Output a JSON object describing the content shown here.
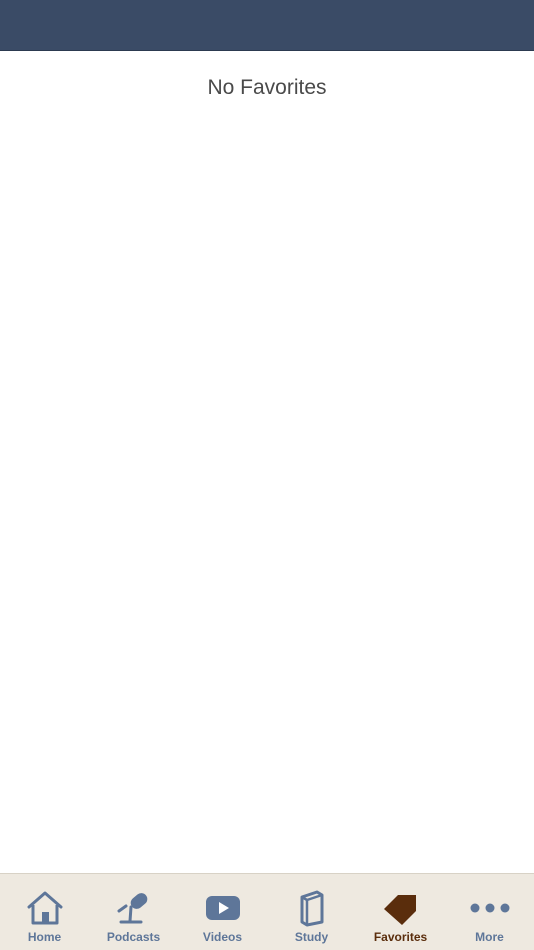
{
  "empty_state": {
    "message": "No Favorites"
  },
  "tabs": [
    {
      "label": "Home",
      "icon": "home-icon",
      "active": false
    },
    {
      "label": "Podcasts",
      "icon": "microphone-icon",
      "active": false
    },
    {
      "label": "Videos",
      "icon": "video-play-icon",
      "active": false
    },
    {
      "label": "Study",
      "icon": "book-icon",
      "active": false
    },
    {
      "label": "Favorites",
      "icon": "bookmark-tag-icon",
      "active": true
    },
    {
      "label": "More",
      "icon": "more-dots-icon",
      "active": false
    }
  ],
  "colors": {
    "header": "#3a4b66",
    "tab_bar": "#eee9e0",
    "tab_inactive": "#5e7699",
    "tab_active": "#5a2d0c",
    "text": "#4a4a4a"
  }
}
